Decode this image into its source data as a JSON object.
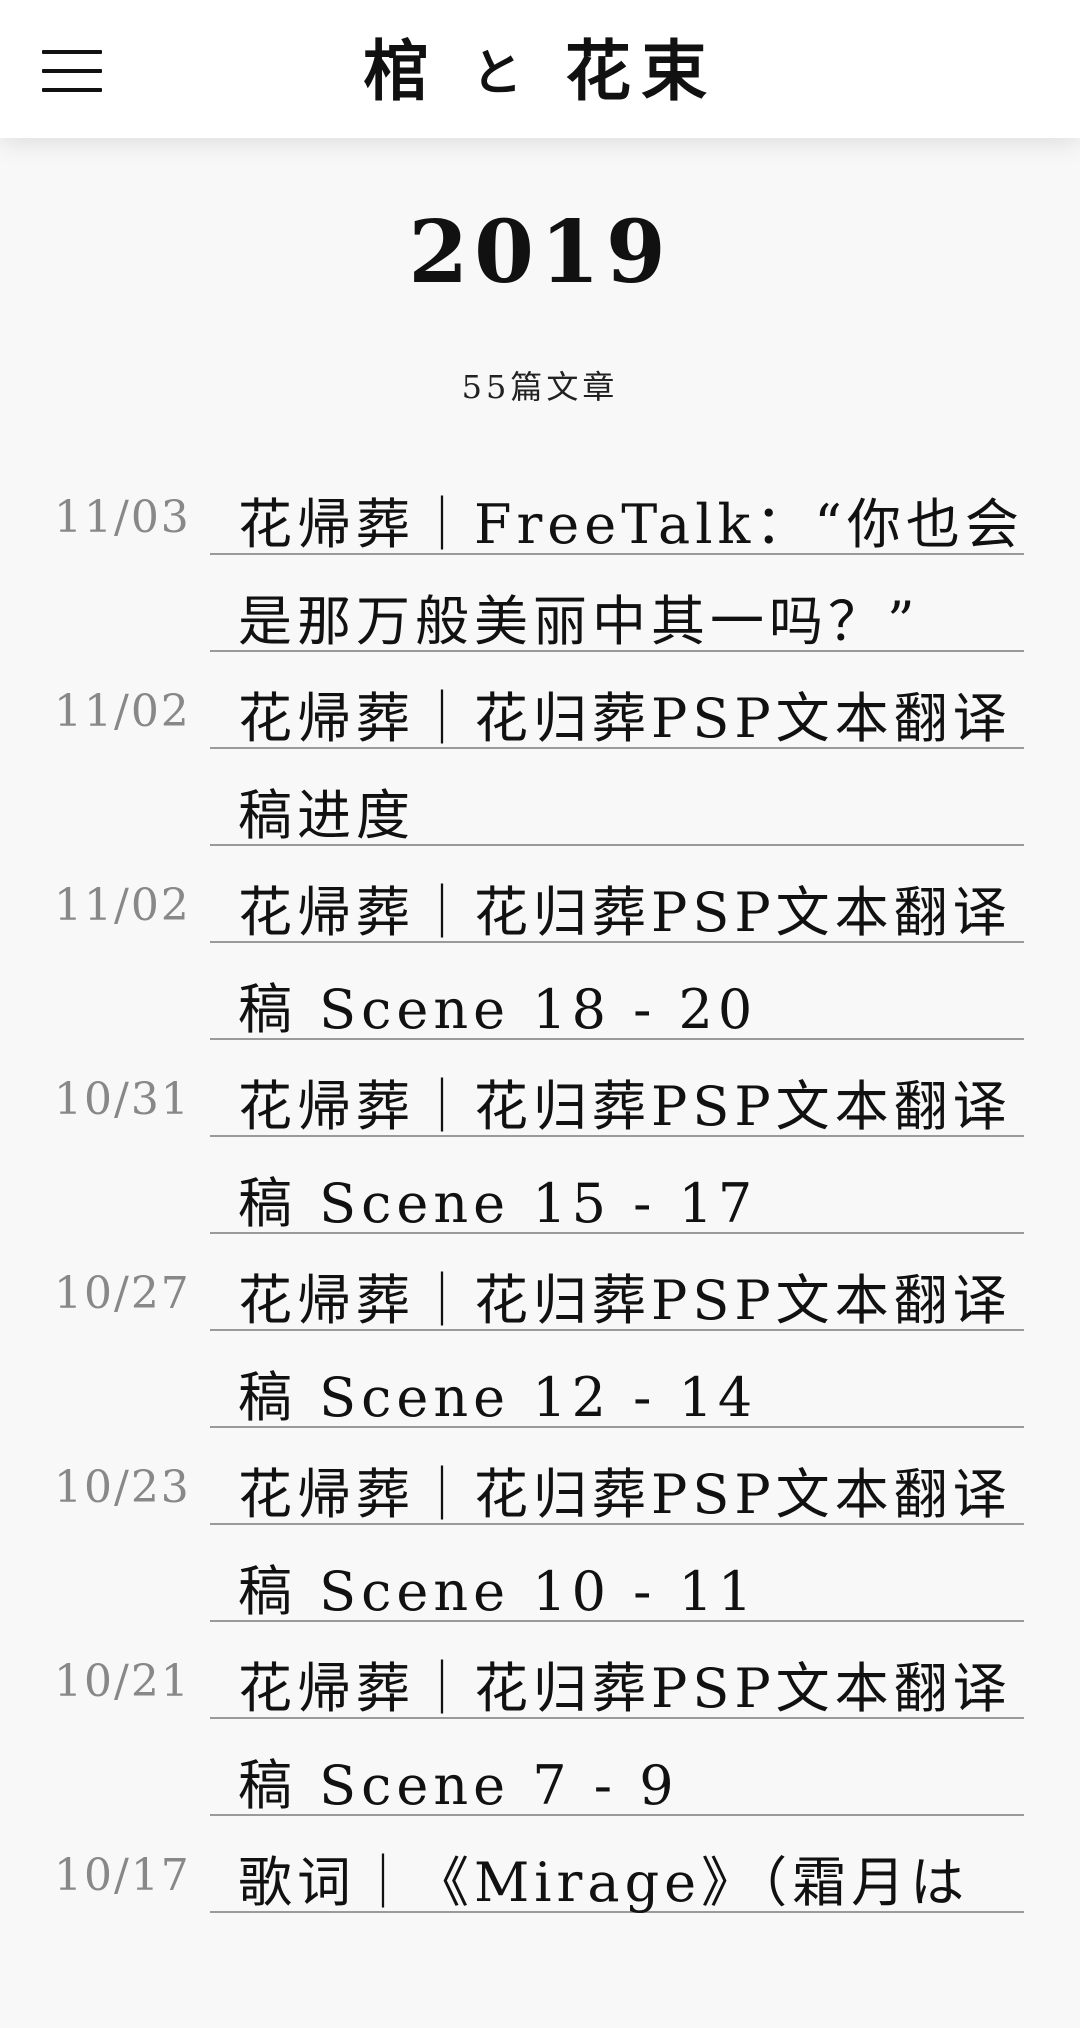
{
  "header": {
    "title_part1": "棺",
    "title_part2": "と",
    "title_part3": "花束"
  },
  "archive": {
    "year": "2019",
    "count": "55篇文章"
  },
  "posts": [
    {
      "date": "11/03",
      "title": "花帰葬｜FreeTalk：“你也会是那万般美丽中其一吗？”"
    },
    {
      "date": "11/02",
      "title": "花帰葬｜花归葬PSP文本翻译稿进度"
    },
    {
      "date": "11/02",
      "title": "花帰葬｜花归葬PSP文本翻译稿 Scene 18 - 20"
    },
    {
      "date": "10/31",
      "title": "花帰葬｜花归葬PSP文本翻译稿 Scene 15 - 17"
    },
    {
      "date": "10/27",
      "title": "花帰葬｜花归葬PSP文本翻译稿 Scene 12 - 14"
    },
    {
      "date": "10/23",
      "title": "花帰葬｜花归葬PSP文本翻译稿 Scene 10 - 11"
    },
    {
      "date": "10/21",
      "title": "花帰葬｜花归葬PSP文本翻译稿 Scene 7 - 9"
    },
    {
      "date": "10/17",
      "title": "歌词｜《Mirage》（霜月は"
    }
  ]
}
